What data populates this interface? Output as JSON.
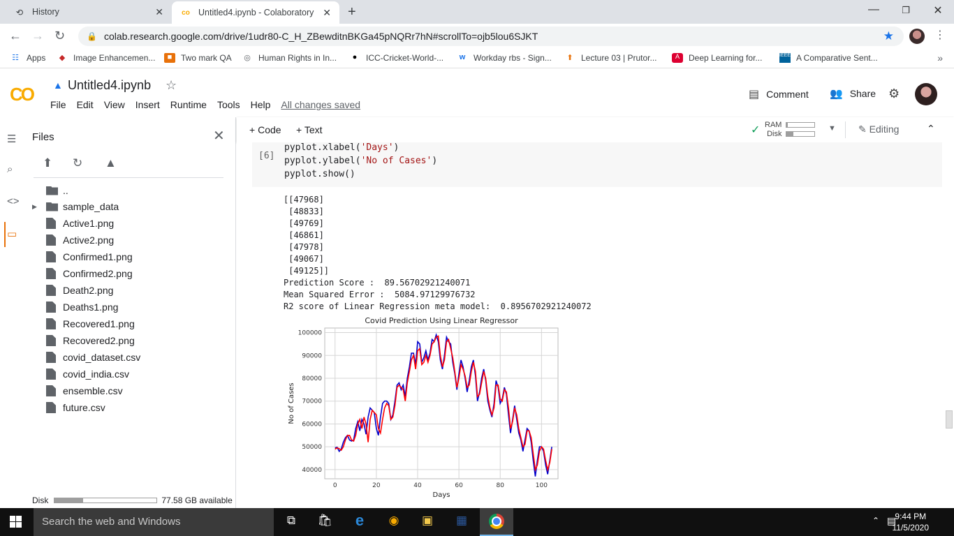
{
  "browser": {
    "tabs": [
      {
        "title": "History",
        "icon": "history-icon"
      },
      {
        "title": "Untitled4.ipynb - Colaboratory",
        "icon": "colab-icon"
      }
    ],
    "url": "colab.research.google.com/drive/1udr80-C_H_ZBewditnBKGa45pNQRr7hN#scrollTo=ojb5lou6SJKT",
    "bookmarks": [
      "Apps",
      "Image Enhancemen...",
      "Two mark QA",
      "Human Rights in In...",
      "ICC-Cricket-World-...",
      "Workday rbs - Sign...",
      "Lecture 03 | Prutor...",
      "Deep Learning for...",
      "A Comparative Sent..."
    ]
  },
  "colab": {
    "logo": "CO",
    "notebook_title": "Untitled4.ipynb",
    "menu": [
      "File",
      "Edit",
      "View",
      "Insert",
      "Runtime",
      "Tools",
      "Help"
    ],
    "save_status": "All changes saved",
    "comment_label": "Comment",
    "share_label": "Share"
  },
  "sidebar": {
    "title": "Files",
    "parent_dir": "..",
    "folders": [
      "sample_data"
    ],
    "files": [
      "Active1.png",
      "Active2.png",
      "Confirmed1.png",
      "Confirmed2.png",
      "Death2.png",
      "Deaths1.png",
      "Recovered1.png",
      "Recovered2.png",
      "covid_dataset.csv",
      "covid_india.csv",
      "ensemble.csv",
      "future.csv"
    ],
    "disk_label": "Disk",
    "disk_available": "77.58 GB available",
    "disk_used_fraction": 0.28
  },
  "toolbar": {
    "code_label": "Code",
    "text_label": "Text",
    "ram_label": "RAM",
    "disk_label": "Disk",
    "ram_used_fraction": 0.05,
    "disk_used_fraction": 0.25,
    "editing_label": "Editing"
  },
  "cell": {
    "exec_count": "[6]",
    "code_lines": [
      {
        "pre": "pyplot.xlabel(",
        "str": "'Days'",
        "post": ")"
      },
      {
        "pre": "pyplot.ylabel(",
        "str": "'No of Cases'",
        "post": ")"
      },
      {
        "pre": "pyplot.show()",
        "str": "",
        "post": ""
      }
    ],
    "output_lines": [
      "[[47968]",
      " [48833]",
      " [49769]",
      " [46861]",
      " [47978]",
      " [49067]",
      " [49125]]",
      "Prediction Score :  89.56702921240071",
      "Mean Squared Error :  5084.97129976732",
      "R2 score of Linear Regression meta model:  0.8956702921240072"
    ]
  },
  "chart_data": {
    "type": "line",
    "title": "Covid Prediction Using Linear Regressor",
    "xlabel": "Days",
    "ylabel": "No of Cases",
    "xlim": [
      -5,
      108
    ],
    "ylim": [
      36000,
      102000
    ],
    "xticks": [
      0,
      20,
      40,
      60,
      80,
      100
    ],
    "yticks": [
      40000,
      50000,
      60000,
      70000,
      80000,
      90000,
      100000
    ],
    "grid": true,
    "series": [
      {
        "color": "#0000cc",
        "values": [
          49500,
          49800,
          48000,
          49000,
          52000,
          54000,
          55000,
          53000,
          52500,
          53000,
          58000,
          61000,
          57000,
          62000,
          60000,
          55500,
          63000,
          67000,
          66000,
          65000,
          58000,
          55000,
          63000,
          69000,
          70000,
          70000,
          69000,
          62000,
          64000,
          70000,
          77000,
          78000,
          75000,
          77000,
          72000,
          80000,
          85000,
          91000,
          91000,
          86000,
          96000,
          95000,
          87000,
          89000,
          92000,
          88000,
          91000,
          97000,
          96000,
          99000,
          96000,
          88000,
          84000,
          90000,
          98000,
          96000,
          95000,
          87000,
          82000,
          75000,
          82000,
          88000,
          85000,
          80000,
          74000,
          79000,
          85000,
          88000,
          81000,
          70000,
          74000,
          80000,
          84000,
          79000,
          70000,
          66000,
          63000,
          69000,
          79000,
          76000,
          69000,
          71000,
          76000,
          73000,
          64000,
          56000,
          62000,
          68000,
          62000,
          56000,
          53000,
          48000,
          53000,
          58000,
          57000,
          52000,
          44000,
          37000,
          44000,
          50000,
          50000,
          48000,
          42000,
          38000,
          44000,
          50000
        ]
      },
      {
        "color": "#ff0000",
        "values": [
          49000,
          49500,
          49200,
          48500,
          50000,
          53000,
          55000,
          55000,
          53000,
          52500,
          55000,
          60000,
          62000,
          58000,
          63000,
          60000,
          52000,
          62000,
          66000,
          65000,
          64000,
          58000,
          56000,
          62000,
          67000,
          69000,
          68000,
          62000,
          63000,
          68000,
          76000,
          77000,
          76000,
          75000,
          70000,
          78000,
          83000,
          88000,
          90000,
          84000,
          92000,
          93000,
          86000,
          87000,
          90000,
          87000,
          90000,
          95000,
          96000,
          98000,
          98500,
          90000,
          85000,
          88000,
          96000,
          97000,
          93000,
          89000,
          83000,
          76000,
          80000,
          86000,
          84000,
          81000,
          76000,
          77000,
          83000,
          87000,
          83000,
          72000,
          73000,
          78000,
          83000,
          80000,
          72000,
          67000,
          64000,
          67000,
          77000,
          77000,
          71000,
          70000,
          75000,
          74000,
          67000,
          58000,
          61000,
          67000,
          64000,
          58000,
          54000,
          50000,
          51000,
          57000,
          57000,
          54000,
          47000,
          40000,
          42000,
          48000,
          50000,
          49000,
          44000,
          40000,
          43000,
          49000
        ]
      }
    ]
  }
}
